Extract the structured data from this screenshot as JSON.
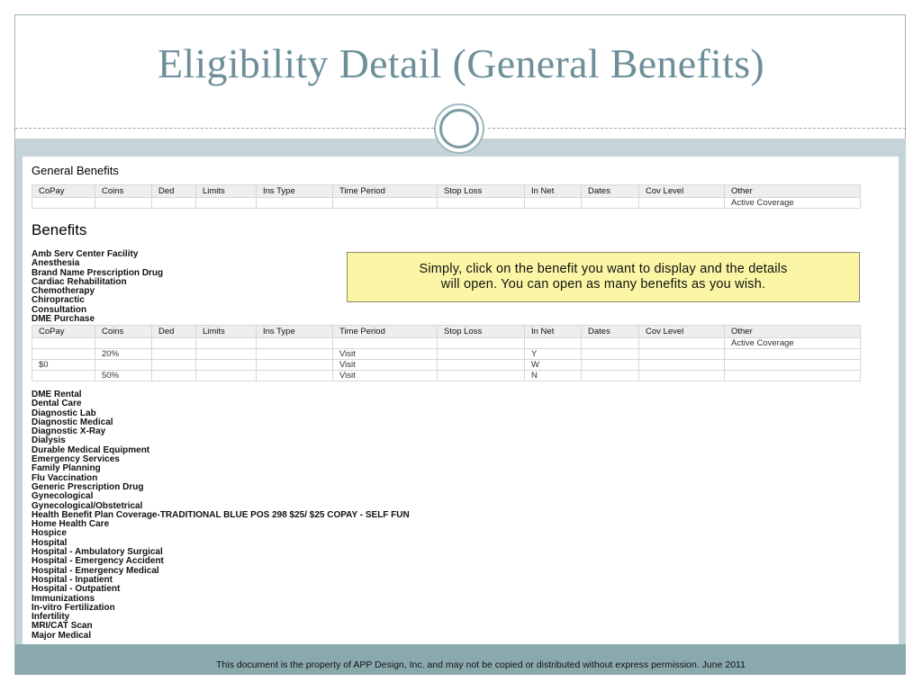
{
  "slide": {
    "title": "Eligibility Detail (General Benefits)",
    "footer": "This document is the property of APP Design, Inc. and may not be copied or distributed without express permission.  June 2011"
  },
  "screen": {
    "general_heading": "General Benefits",
    "benefits_heading": "Benefits",
    "columns": [
      "CoPay",
      "Coins",
      "Ded",
      "Limits",
      "Ins Type",
      "Time Period",
      "Stop Loss",
      "In Net",
      "Dates",
      "Cov Level",
      "Other"
    ],
    "general_rows": [
      [
        "",
        "",
        "",
        "",
        "",
        "",
        "",
        "",
        "",
        "",
        "Active Coverage"
      ]
    ],
    "benefits_top": [
      "Amb Serv Center Facility",
      "Anesthesia",
      "Brand Name Prescription Drug",
      "Cardiac Rehabilitation",
      "Chemotherapy",
      "Chiropractic",
      "Consultation",
      "DME Purchase"
    ],
    "dme_rows": [
      [
        "",
        "",
        "",
        "",
        "",
        "",
        "",
        "",
        "",
        "",
        "Active Coverage"
      ],
      [
        "",
        "20%",
        "",
        "",
        "",
        "Visit",
        "",
        "Y",
        "",
        "",
        ""
      ],
      [
        "$0",
        "",
        "",
        "",
        "",
        "Visit",
        "",
        "W",
        "",
        "",
        ""
      ],
      [
        "",
        "50%",
        "",
        "",
        "",
        "Visit",
        "",
        "N",
        "",
        "",
        ""
      ]
    ],
    "benefits_bottom": [
      "DME Rental",
      "Dental Care",
      "Diagnostic Lab",
      "Diagnostic Medical",
      "Diagnostic X-Ray",
      "Dialysis",
      "Durable Medical Equipment",
      "Emergency Services",
      "Family Planning",
      "Flu Vaccination",
      "Generic Prescription Drug",
      "Gynecological",
      "Gynecological/Obstetrical",
      "Health Benefit Plan Coverage-TRADITIONAL BLUE POS 298 $25/ $25 COPAY - SELF FUN",
      "Home Health Care",
      "Hospice",
      "Hospital",
      "Hospital - Ambulatory Surgical",
      "Hospital - Emergency Accident",
      "Hospital - Emergency Medical",
      "Hospital - Inpatient",
      "Hospital - Outpatient",
      "Immunizations",
      "In-vitro Fertilization",
      "Infertility",
      "MRI/CAT Scan",
      "Major Medical"
    ],
    "callout_line1": "Simply, click on the benefit you want to display and the details",
    "callout_line2": "will open.  You can open as many benefits as you wish."
  },
  "colors": {
    "title": "#6e8f9a",
    "band": "#c4d4d9",
    "footer_bar": "#8aa9ad",
    "callout_bg": "#fbf6a6"
  }
}
